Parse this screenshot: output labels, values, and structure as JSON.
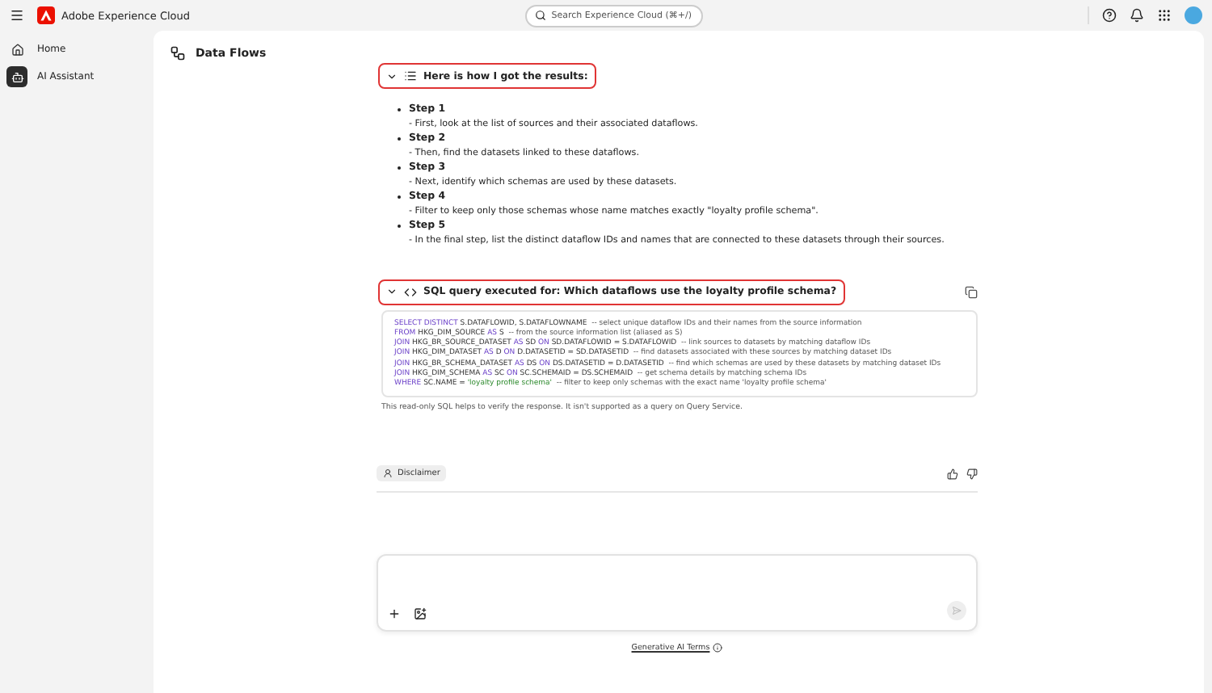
{
  "app": {
    "title": "Adobe Experience Cloud",
    "search": {
      "placeholder": "Search Experience Cloud (⌘+/)"
    }
  },
  "sidebar": {
    "items": [
      {
        "label": "Home",
        "selected": false
      },
      {
        "label": "AI Assistant",
        "selected": true
      }
    ]
  },
  "page": {
    "title": "Data Flows"
  },
  "steps_section": {
    "title": "Here is how I got the results:",
    "expanded": true,
    "highlighted": true,
    "steps": [
      {
        "title": "Step 1",
        "text": "- First, look at the list of sources and their associated dataflows."
      },
      {
        "title": "Step 2",
        "text": "- Then, find the datasets linked to these dataflows."
      },
      {
        "title": "Step 3",
        "text": "- Next, identify which schemas are used by these datasets."
      },
      {
        "title": "Step 4",
        "text": "- Filter to keep only those schemas whose name matches exactly \"loyalty profile schema\"."
      },
      {
        "title": "Step 5",
        "text": "- In the final step, list the distinct dataflow IDs and names that are connected to these datasets through their sources."
      }
    ]
  },
  "sql_section": {
    "title": "SQL query executed for: Which dataflows use the loyalty profile schema?",
    "expanded": true,
    "highlighted": true,
    "lines": [
      [
        {
          "kind": "keyword",
          "text": "SELECT DISTINCT "
        },
        {
          "kind": "plain",
          "text": "S.DATAFLOWID, S.DATAFLOWNAME "
        },
        {
          "kind": "comment",
          "text": " -- select unique dataflow IDs and their names from the source information"
        }
      ],
      [
        {
          "kind": "keyword",
          "text": "FROM "
        },
        {
          "kind": "plain",
          "text": "HKG_DIM_SOURCE "
        },
        {
          "kind": "keyword",
          "text": "AS "
        },
        {
          "kind": "plain",
          "text": "S "
        },
        {
          "kind": "comment",
          "text": " -- from the source information list (aliased as S)"
        }
      ],
      [
        {
          "kind": "keyword",
          "text": "JOIN "
        },
        {
          "kind": "plain",
          "text": "HKG_BR_SOURCE_DATASET "
        },
        {
          "kind": "keyword",
          "text": "AS "
        },
        {
          "kind": "plain",
          "text": "SD "
        },
        {
          "kind": "keyword",
          "text": "ON "
        },
        {
          "kind": "plain",
          "text": "SD.DATAFLOWID = S.DATAFLOWID "
        },
        {
          "kind": "comment",
          "text": " -- link sources to datasets by matching dataflow IDs"
        }
      ],
      [
        {
          "kind": "keyword",
          "text": "JOIN "
        },
        {
          "kind": "plain",
          "text": "HKG_DIM_DATASET "
        },
        {
          "kind": "keyword",
          "text": "AS "
        },
        {
          "kind": "plain",
          "text": "D "
        },
        {
          "kind": "keyword",
          "text": "ON "
        },
        {
          "kind": "plain",
          "text": "D.DATASETID = SD.DATASETID "
        },
        {
          "kind": "comment",
          "text": " -- find datasets associated with these sources by matching dataset IDs"
        }
      ],
      [
        {
          "kind": "keyword",
          "text": "JOIN "
        },
        {
          "kind": "plain",
          "text": "HKG_BR_SCHEMA_DATASET "
        },
        {
          "kind": "keyword",
          "text": "AS "
        },
        {
          "kind": "plain",
          "text": "DS "
        },
        {
          "kind": "keyword",
          "text": "ON "
        },
        {
          "kind": "plain",
          "text": "DS.DATASETID = D.DATASETID "
        },
        {
          "kind": "comment",
          "text": " -- find which schemas are used by these datasets by matching dataset IDs"
        }
      ],
      [
        {
          "kind": "keyword",
          "text": "JOIN "
        },
        {
          "kind": "plain",
          "text": "HKG_DIM_SCHEMA "
        },
        {
          "kind": "keyword",
          "text": "AS "
        },
        {
          "kind": "plain",
          "text": "SC "
        },
        {
          "kind": "keyword",
          "text": "ON "
        },
        {
          "kind": "plain",
          "text": "SC.SCHEMAID = DS.SCHEMAID "
        },
        {
          "kind": "comment",
          "text": " -- get schema details by matching schema IDs"
        }
      ],
      [
        {
          "kind": "keyword",
          "text": "WHERE "
        },
        {
          "kind": "plain",
          "text": "SC.NAME = "
        },
        {
          "kind": "string",
          "text": "'loyalty profile schema' "
        },
        {
          "kind": "comment",
          "text": " -- filter to keep only schemas with the exact name 'loyalty profile schema'"
        }
      ]
    ],
    "note": "This read-only SQL helps to verify the response. It isn't supported as a query on Query Service."
  },
  "disclaimer": "Disclaimer",
  "footer_link": "Generative AI Terms"
}
